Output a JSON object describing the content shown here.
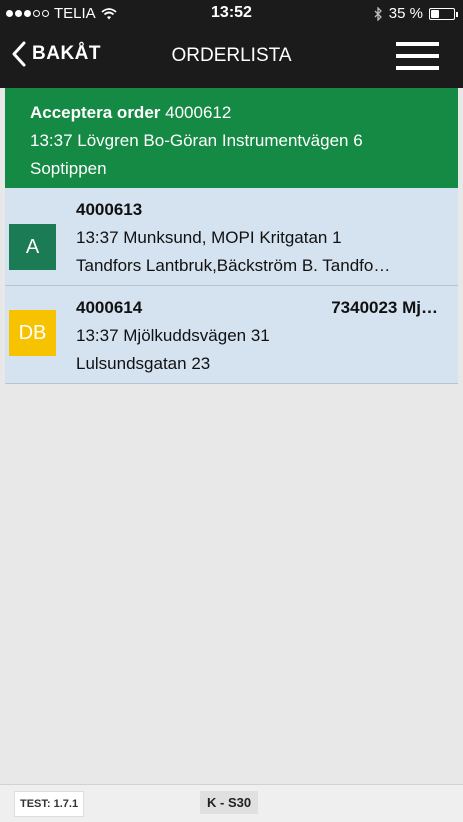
{
  "status_bar": {
    "carrier": "TELIA",
    "time": "13:52",
    "battery_text": "35 %",
    "battery_level": 0.35,
    "signal_bars": 3,
    "icons": [
      "signal-dots-icon",
      "wifi-icon",
      "bluetooth-icon",
      "battery-icon"
    ]
  },
  "navbar": {
    "back_label": "BAKÅT",
    "title": "ORDERLISTA",
    "icons": [
      "chevron-left-icon",
      "hamburger-menu-icon"
    ]
  },
  "accept_card": {
    "heading_bold": "Acceptera order",
    "order_number": "4000612",
    "line2": "13:37 Lövgren Bo-Göran Instrumentvägen 6",
    "line3": "Soptippen",
    "bg_color": "#158a45"
  },
  "orders": [
    {
      "badge": "A",
      "badge_color": "#1b7b55",
      "badge_text_color": "#ffffff",
      "number": "4000613",
      "ref": "",
      "line2": "13:37 Munksund, MOPI Kritgatan 1",
      "line3": "Tandfors Lantbruk,Bäckström B. Tandfo…"
    },
    {
      "badge": "DB",
      "badge_color": "#f7c300",
      "badge_text_color": "#ffffff",
      "number": "4000614",
      "ref": "7340023 Mj…",
      "line2": "13:37 Mjölkuddsvägen 31",
      "line3": "Lulsundsgatan 23"
    }
  ],
  "footer": {
    "version": "TEST: 1.7.1",
    "vehicle": "K - S30"
  }
}
